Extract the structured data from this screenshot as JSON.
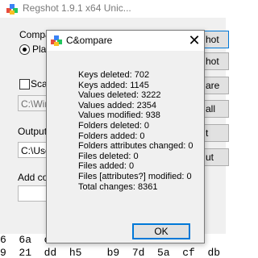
{
  "background_window": {
    "title": "Regshot 1.9.1 x64 Unic...",
    "compare_label": "Compar",
    "plain_label": "Plain",
    "scan_label": "Scan",
    "scan_path": "C:\\Wir",
    "output_label": "Output",
    "output_path": "C:\\Use",
    "add_comment_label": "Add co",
    "buttons": [
      "hot",
      "hot",
      "are",
      "all",
      "t",
      "ut"
    ]
  },
  "hex_dump": [
    "6  6a  cc                                 c  c9",
    "9  21  dd  h5    b9  7d  5a  cf  db  79  e3"
  ],
  "dialog": {
    "title": "C&ompare",
    "stats": [
      "Keys deleted: 702",
      "Keys added: 1145",
      "Values deleted: 3222",
      "Values added: 2354",
      "Values modified: 938",
      "Folders deleted: 0",
      "Folders added: 0",
      "Folders attributes changed: 0",
      "Files deleted: 0",
      "Files added: 0",
      "Files [attributes?] modified: 0",
      "Total changes: 8361"
    ],
    "ok_label": "OK"
  },
  "icons": [
    "regshot-app-icon",
    "close-icon",
    "radio-selected-icon",
    "checkbox-icon"
  ],
  "colors": {
    "accent": "#0078d7",
    "dialog_bg": "#f0f0f0",
    "title_bg": "#ffffff"
  }
}
